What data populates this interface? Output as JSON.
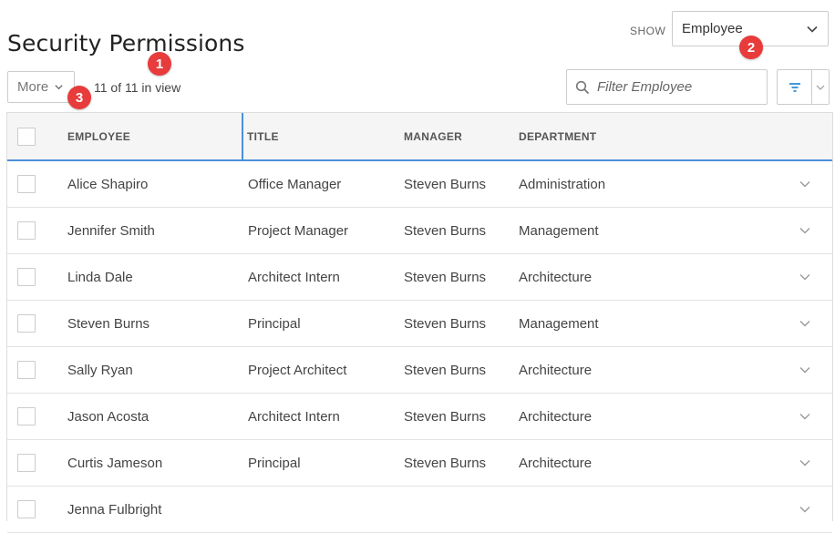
{
  "page": {
    "title": "Security Permissions"
  },
  "show": {
    "label": "SHOW",
    "selected": "Employee"
  },
  "toolbar": {
    "more_label": "More",
    "view_count": "11 of 11 in view",
    "filter_placeholder": "Filter Employee"
  },
  "badges": [
    "1",
    "2",
    "3"
  ],
  "table": {
    "headers": {
      "employee": "EMPLOYEE",
      "title": "TITLE",
      "manager": "MANAGER",
      "department": "DEPARTMENT"
    },
    "rows": [
      {
        "employee": "Alice Shapiro",
        "title": "Office Manager",
        "manager": "Steven Burns",
        "department": "Administration"
      },
      {
        "employee": "Jennifer Smith",
        "title": "Project Manager",
        "manager": "Steven Burns",
        "department": "Management"
      },
      {
        "employee": "Linda Dale",
        "title": "Architect Intern",
        "manager": "Steven Burns",
        "department": "Architecture"
      },
      {
        "employee": "Steven Burns",
        "title": "Principal",
        "manager": "Steven Burns",
        "department": "Management"
      },
      {
        "employee": "Sally Ryan",
        "title": "Project Architect",
        "manager": "Steven Burns",
        "department": "Architecture"
      },
      {
        "employee": "Jason Acosta",
        "title": "Architect Intern",
        "manager": "Steven Burns",
        "department": "Architecture"
      },
      {
        "employee": "Curtis Jameson",
        "title": "Principal",
        "manager": "Steven Burns",
        "department": "Architecture"
      },
      {
        "employee": "Jenna Fulbright",
        "title": "",
        "manager": "",
        "department": ""
      }
    ]
  },
  "colors": {
    "accent": "#4a90d9",
    "badge": "#e83b3b",
    "filter_icon": "#2d8fd5"
  },
  "icons": {
    "dropdown": "chevron-down-icon",
    "search": "search-icon",
    "filter": "filter-icon",
    "row_expand": "chevron-down-icon"
  }
}
